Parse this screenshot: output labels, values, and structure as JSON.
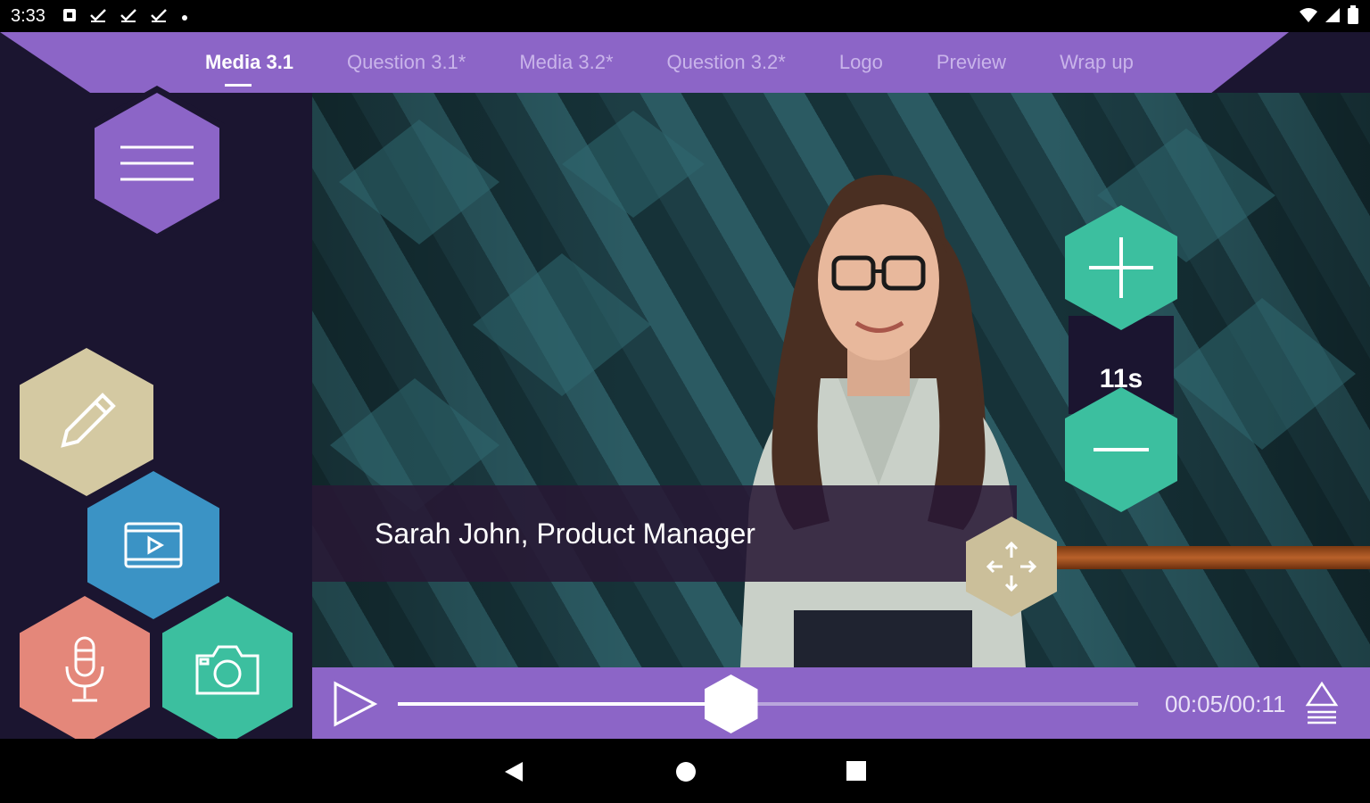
{
  "status_bar": {
    "time": "3:33",
    "icons": [
      "notification-icon",
      "check-icon",
      "check-icon",
      "check-icon",
      "dot-icon"
    ],
    "right_icons": [
      "wifi-icon",
      "signal-icon",
      "battery-icon"
    ]
  },
  "tabs": [
    {
      "label": "Media 3.1",
      "active": true
    },
    {
      "label": "Question 3.1*",
      "active": false
    },
    {
      "label": "Media 3.2*",
      "active": false
    },
    {
      "label": "Question 3.2*",
      "active": false
    },
    {
      "label": "Logo",
      "active": false
    },
    {
      "label": "Preview",
      "active": false
    },
    {
      "label": "Wrap up",
      "active": false
    }
  ],
  "video": {
    "lower_third": "Sarah John, Product Manager",
    "timer": "11s"
  },
  "player": {
    "time": "00:05/00:11",
    "progress": 0.45
  },
  "colors": {
    "accent": "#8c65c7",
    "teal": "#3cbf9f",
    "beige": "#d4c9a2",
    "blue": "#3b93c5",
    "salmon": "#e4877a",
    "background": "#1b1530"
  }
}
